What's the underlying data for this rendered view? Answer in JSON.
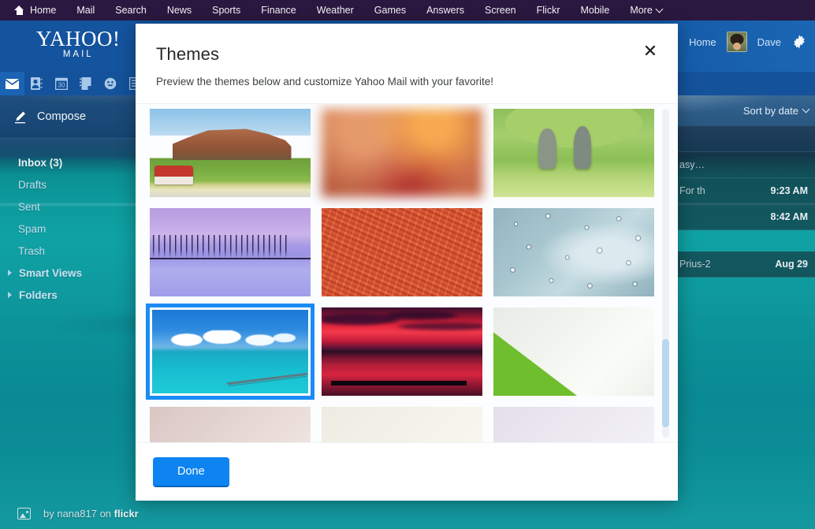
{
  "topnav": {
    "items": [
      {
        "label": "Home",
        "icon": "home-icon"
      },
      {
        "label": "Mail"
      },
      {
        "label": "Search"
      },
      {
        "label": "News"
      },
      {
        "label": "Sports"
      },
      {
        "label": "Finance"
      },
      {
        "label": "Weather"
      },
      {
        "label": "Games"
      },
      {
        "label": "Answers"
      },
      {
        "label": "Screen"
      },
      {
        "label": "Flickr"
      },
      {
        "label": "Mobile"
      },
      {
        "label": "More"
      }
    ],
    "bg_color": "#2b1840"
  },
  "header": {
    "logo_word": "YAHOO!",
    "logo_sub": "MAIL",
    "home_link": "Home",
    "user_name": "Dave",
    "gear_icon": "gear-icon",
    "bg_color": "#15539e"
  },
  "appbar": {
    "icons": [
      {
        "name": "mail-icon",
        "active": true
      },
      {
        "name": "contacts-icon",
        "active": false
      },
      {
        "name": "calendar-icon",
        "label": "30",
        "active": false
      },
      {
        "name": "notepad-icon",
        "active": false
      },
      {
        "name": "smiley-icon",
        "active": false
      },
      {
        "name": "more-apps-icon",
        "active": false
      }
    ]
  },
  "sidebar": {
    "compose_label": "Compose",
    "compose_icon": "pencil-icon",
    "items": [
      {
        "label": "Inbox (3)",
        "bold": true
      },
      {
        "label": "Drafts",
        "bold": false
      },
      {
        "label": "Sent",
        "bold": false
      },
      {
        "label": "Spam",
        "bold": false
      },
      {
        "label": "Trash",
        "bold": false
      }
    ],
    "groups": [
      {
        "label": "Smart Views"
      },
      {
        "label": "Folders"
      }
    ]
  },
  "maillist": {
    "sort_label": "Sort by date",
    "rows": [
      {
        "subject": "",
        "time": ""
      },
      {
        "subject": "asy…",
        "time": ""
      },
      {
        "subject": "For th",
        "time": "9:23 AM"
      },
      {
        "subject": "",
        "time": "8:42 AM"
      },
      {
        "subject": "Prius-2",
        "time": "Aug 29"
      }
    ]
  },
  "credit": {
    "prefix": "by nana817 on",
    "site": "flickr",
    "icon": "photo-icon"
  },
  "modal": {
    "title": "Themes",
    "subtitle": "Preview the themes below and customize Yahoo Mail with your favorite!",
    "close_icon": "close-icon",
    "done_label": "Done",
    "accent_color": "#0d84f2",
    "selection_color": "#1b8cf5",
    "themes": [
      {
        "name": "red-van-mesa",
        "art": "t-van",
        "selected": false
      },
      {
        "name": "warm-blur",
        "art": "t-blur",
        "selected": false
      },
      {
        "name": "green-army-men",
        "art": "t-army",
        "selected": false
      },
      {
        "name": "purple-winter",
        "art": "t-winter",
        "selected": false
      },
      {
        "name": "orange-sand-dunes",
        "art": "t-dune",
        "selected": false
      },
      {
        "name": "water-droplets",
        "art": "t-drops",
        "selected": false
      },
      {
        "name": "turquoise-ocean-pier",
        "art": "t-ocean",
        "selected": true
      },
      {
        "name": "red-sunset-water",
        "art": "t-sunset",
        "selected": false
      },
      {
        "name": "green-triangle",
        "art": "t-green",
        "selected": false
      },
      {
        "name": "pale-pink",
        "art": "t-p1",
        "selected": false
      },
      {
        "name": "pale-beige",
        "art": "t-p2",
        "selected": false
      },
      {
        "name": "pale-lavender",
        "art": "t-p3",
        "selected": false
      }
    ]
  }
}
